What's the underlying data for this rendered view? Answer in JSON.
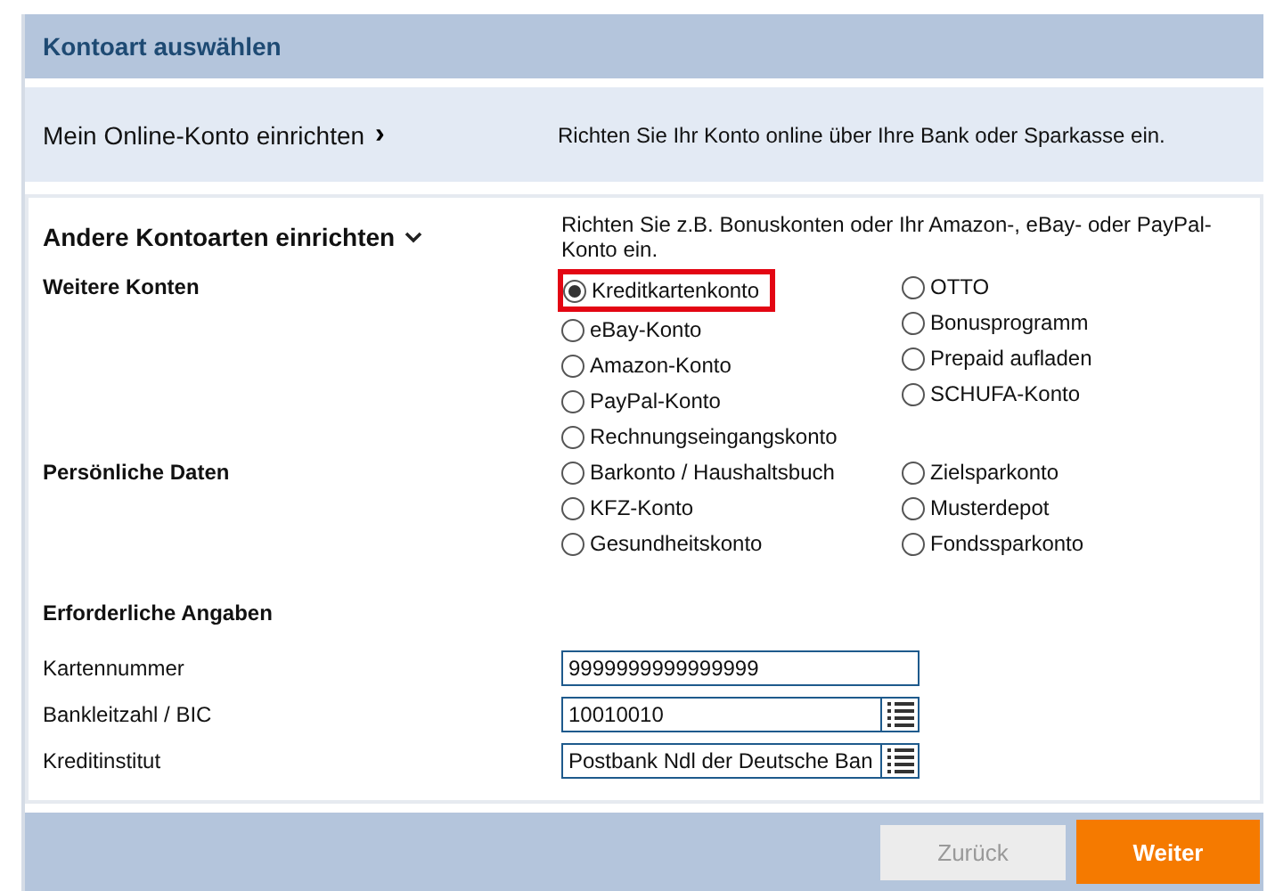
{
  "header": {
    "title": "Kontoart auswählen"
  },
  "online_section": {
    "title": "Mein Online-Konto einrichten",
    "chevron": "›",
    "description": "Richten Sie Ihr Konto online über Ihre Bank oder Sparkasse ein."
  },
  "other_section": {
    "title": "Andere Kontoarten einrichten",
    "expanded": true,
    "description": "Richten Sie z.B. Bonuskonten oder Ihr Amazon-, eBay- oder PayPal-Konto ein.",
    "groups": [
      {
        "label": "Weitere Konten",
        "columns": [
          [
            {
              "label": "Kreditkartenkonto",
              "selected": true,
              "highlighted": true
            },
            {
              "label": "eBay-Konto",
              "selected": false,
              "highlighted": false
            },
            {
              "label": "Amazon-Konto",
              "selected": false,
              "highlighted": false
            },
            {
              "label": "PayPal-Konto",
              "selected": false,
              "highlighted": false
            },
            {
              "label": "Rechnungseingangskonto",
              "selected": false,
              "highlighted": false
            }
          ],
          [
            {
              "label": "OTTO",
              "selected": false,
              "highlighted": false
            },
            {
              "label": "Bonusprogramm",
              "selected": false,
              "highlighted": false
            },
            {
              "label": "Prepaid aufladen",
              "selected": false,
              "highlighted": false
            },
            {
              "label": "SCHUFA-Konto",
              "selected": false,
              "highlighted": false
            }
          ]
        ]
      },
      {
        "label": "Persönliche Daten",
        "columns": [
          [
            {
              "label": "Barkonto / Haushaltsbuch",
              "selected": false,
              "highlighted": false
            },
            {
              "label": "KFZ-Konto",
              "selected": false,
              "highlighted": false
            },
            {
              "label": "Gesundheitskonto",
              "selected": false,
              "highlighted": false
            }
          ],
          [
            {
              "label": "Zielsparkonto",
              "selected": false,
              "highlighted": false
            },
            {
              "label": "Musterdepot",
              "selected": false,
              "highlighted": false
            },
            {
              "label": "Fondssparkonto",
              "selected": false,
              "highlighted": false
            }
          ]
        ]
      }
    ]
  },
  "required": {
    "title": "Erforderliche Angaben",
    "fields": [
      {
        "label": "Kartennummer",
        "value": "9999999999999999",
        "kind": "text"
      },
      {
        "label": "Bankleitzahl / BIC",
        "value": "10010010",
        "kind": "lookup"
      },
      {
        "label": "Kreditinstitut",
        "value": "Postbank Ndl der Deutsche Ban",
        "kind": "lookup"
      }
    ]
  },
  "buttons": [
    {
      "label": "Zurück",
      "disabled": true,
      "kind": "secondary"
    },
    {
      "label": "Weiter",
      "disabled": false,
      "kind": "primary"
    }
  ]
}
